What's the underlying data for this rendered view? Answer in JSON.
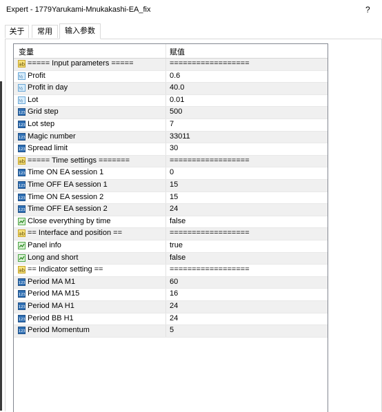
{
  "window": {
    "title": "Expert - 1779Yarukami-Mnukakashi-EA_fix",
    "help": "?"
  },
  "tabs": [
    {
      "label": "关于"
    },
    {
      "label": "常用"
    },
    {
      "label": "输入参数"
    }
  ],
  "grid": {
    "col_variable": "变量",
    "col_value": "赋值",
    "rows": [
      {
        "name": "===== Input parameters =====",
        "value": "==================",
        "icon": "ab-string-icon"
      },
      {
        "name": "Profit",
        "value": "0.6",
        "icon": "v2-double-icon"
      },
      {
        "name": "Profit in day",
        "value": "40.0",
        "icon": "v2-double-icon"
      },
      {
        "name": "Lot",
        "value": "0.01",
        "icon": "v2-double-icon"
      },
      {
        "name": "Grid step",
        "value": "500",
        "icon": "123-integer-icon"
      },
      {
        "name": "Lot step",
        "value": "7",
        "icon": "123-integer-icon"
      },
      {
        "name": "Magic number",
        "value": "33011",
        "icon": "123-integer-icon"
      },
      {
        "name": "Spread limit",
        "value": "30",
        "icon": "123-integer-icon"
      },
      {
        "name": "===== Time settings =======",
        "value": "==================",
        "icon": "ab-string-icon"
      },
      {
        "name": "Time ON EA session 1",
        "value": "0",
        "icon": "123-integer-icon"
      },
      {
        "name": "Time OFF EA session 1",
        "value": "15",
        "icon": "123-integer-icon"
      },
      {
        "name": "Time ON EA session 2",
        "value": "15",
        "icon": "123-integer-icon"
      },
      {
        "name": "Time OFF EA session 2",
        "value": "24",
        "icon": "123-integer-icon"
      },
      {
        "name": "Close everything by time",
        "value": "false",
        "icon": "bool-icon"
      },
      {
        "name": "== Interface and position ==",
        "value": "==================",
        "icon": "ab-string-icon"
      },
      {
        "name": "Panel info",
        "value": "true",
        "icon": "bool-icon"
      },
      {
        "name": "Long and short",
        "value": "false",
        "icon": "bool-icon"
      },
      {
        "name": "== Indicator setting ==",
        "value": "==================",
        "icon": "ab-string-icon"
      },
      {
        "name": "Period MA M1",
        "value": "60",
        "icon": "123-integer-icon"
      },
      {
        "name": "Period MA M15",
        "value": "16",
        "icon": "123-integer-icon"
      },
      {
        "name": "Period MA H1",
        "value": "24",
        "icon": "123-integer-icon"
      },
      {
        "name": "Period BB H1",
        "value": "24",
        "icon": "123-integer-icon"
      },
      {
        "name": "Period Momentum",
        "value": "5",
        "icon": "123-integer-icon"
      }
    ]
  }
}
